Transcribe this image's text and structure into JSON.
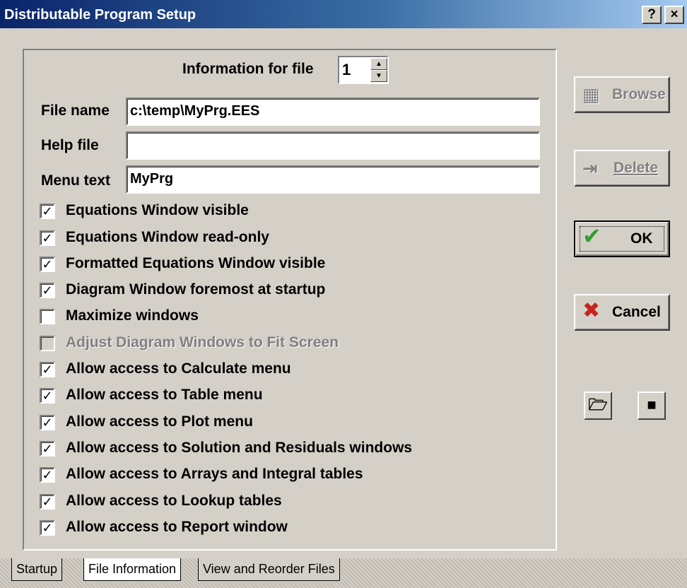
{
  "window": {
    "title": "Distributable Program Setup",
    "help_button": "?",
    "close_button": "×"
  },
  "file_info": {
    "info_label": "Information for file",
    "file_number": "1",
    "file_name_label": "File name",
    "file_name_value": "c:\\temp\\MyPrg.EES",
    "help_file_label": "Help file",
    "help_file_value": "",
    "menu_text_label": "Menu text",
    "menu_text_value": "MyPrg"
  },
  "options": [
    {
      "label": "Equations Window visible",
      "checked": true,
      "enabled": true
    },
    {
      "label": "Equations Window read-only",
      "checked": true,
      "enabled": true
    },
    {
      "label": "Formatted Equations Window visible",
      "checked": true,
      "enabled": true
    },
    {
      "label": "Diagram Window foremost at startup",
      "checked": true,
      "enabled": true
    },
    {
      "label": "Maximize windows",
      "checked": false,
      "enabled": true
    },
    {
      "label": "Adjust Diagram Windows to Fit Screen",
      "checked": false,
      "enabled": false
    },
    {
      "label": "Allow access to Calculate menu",
      "checked": true,
      "enabled": true
    },
    {
      "label": "Allow access to Table menu",
      "checked": true,
      "enabled": true
    },
    {
      "label": "Allow access to Plot menu",
      "checked": true,
      "enabled": true
    },
    {
      "label": "Allow access to Solution and Residuals windows",
      "checked": true,
      "enabled": true
    },
    {
      "label": "Allow access to Arrays and Integral tables",
      "checked": true,
      "enabled": true
    },
    {
      "label": "Allow access to Lookup tables",
      "checked": true,
      "enabled": true
    },
    {
      "label": "Allow access to Report window",
      "checked": true,
      "enabled": true
    }
  ],
  "buttons": {
    "browse": "Browse",
    "delete": "Delete",
    "ok": "OK",
    "cancel": "Cancel"
  },
  "icons": {
    "browse": "browse-icon",
    "delete": "delete-icon",
    "ok": "checkmark-icon",
    "cancel": "x-icon",
    "open": "open-file-icon",
    "save": "floppy-disk-icon"
  },
  "colors": {
    "ok_check": "#2e9e2e",
    "cancel_x": "#c8231e",
    "title_start": "#0a246a",
    "title_end": "#a6caf0"
  },
  "tabs": [
    {
      "label": "Startup",
      "active": false
    },
    {
      "label": "File Information",
      "active": true
    },
    {
      "label": "View and Reorder Files",
      "active": false
    }
  ]
}
